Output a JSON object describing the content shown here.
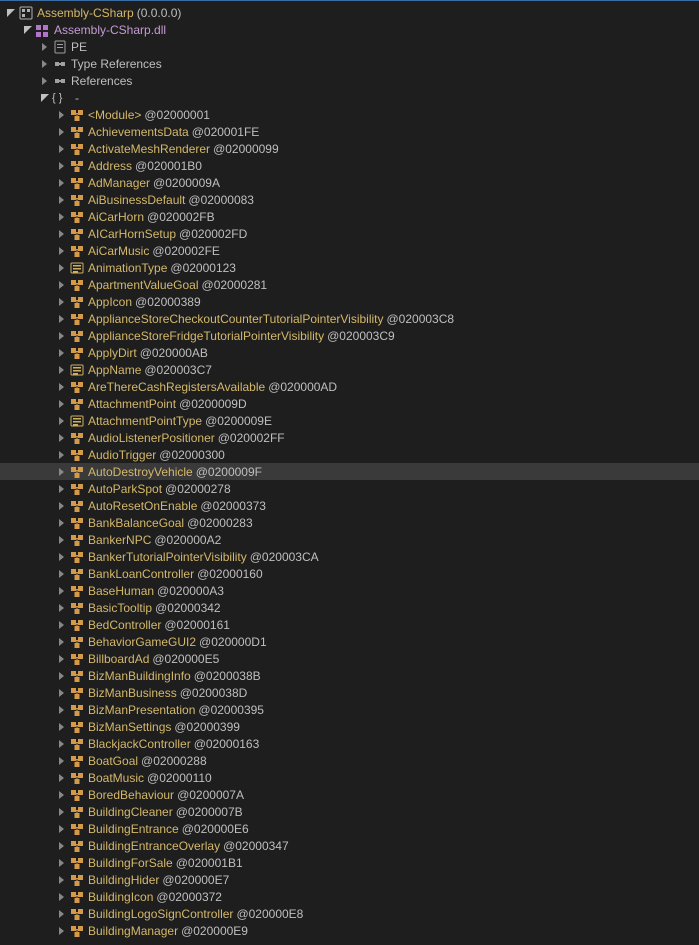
{
  "root": {
    "label": "Assembly-CSharp",
    "version": "(0.0.0.0)",
    "icon": "assembly"
  },
  "dll": {
    "label": "Assembly-CSharp.dll",
    "icon": "module"
  },
  "sections": {
    "pe": "PE",
    "typeRefs": "Type References",
    "refs": "References",
    "ns": "-"
  },
  "types": [
    {
      "name": "<Module>",
      "addr": "@02000001",
      "icon": "class"
    },
    {
      "name": "AchievementsData",
      "addr": "@020001FE",
      "icon": "class"
    },
    {
      "name": "ActivateMeshRenderer",
      "addr": "@02000099",
      "icon": "class"
    },
    {
      "name": "Address",
      "addr": "@020001B0",
      "icon": "class"
    },
    {
      "name": "AdManager",
      "addr": "@0200009A",
      "icon": "class"
    },
    {
      "name": "AiBusinessDefault",
      "addr": "@02000083",
      "icon": "class"
    },
    {
      "name": "AiCarHorn",
      "addr": "@020002FB",
      "icon": "class"
    },
    {
      "name": "AICarHornSetup",
      "addr": "@020002FD",
      "icon": "class"
    },
    {
      "name": "AiCarMusic",
      "addr": "@020002FE",
      "icon": "class"
    },
    {
      "name": "AnimationType",
      "addr": "@02000123",
      "icon": "enum"
    },
    {
      "name": "ApartmentValueGoal",
      "addr": "@02000281",
      "icon": "class"
    },
    {
      "name": "AppIcon",
      "addr": "@02000389",
      "icon": "class"
    },
    {
      "name": "ApplianceStoreCheckoutCounterTutorialPointerVisibility",
      "addr": "@020003C8",
      "icon": "class"
    },
    {
      "name": "ApplianceStoreFridgeTutorialPointerVisibility",
      "addr": "@020003C9",
      "icon": "class"
    },
    {
      "name": "ApplyDirt",
      "addr": "@020000AB",
      "icon": "class"
    },
    {
      "name": "AppName",
      "addr": "@020003C7",
      "icon": "enum"
    },
    {
      "name": "AreThereCashRegistersAvailable",
      "addr": "@020000AD",
      "icon": "class"
    },
    {
      "name": "AttachmentPoint",
      "addr": "@0200009D",
      "icon": "class"
    },
    {
      "name": "AttachmentPointType",
      "addr": "@0200009E",
      "icon": "enum"
    },
    {
      "name": "AudioListenerPositioner",
      "addr": "@020002FF",
      "icon": "class"
    },
    {
      "name": "AudioTrigger",
      "addr": "@02000300",
      "icon": "class"
    },
    {
      "name": "AutoDestroyVehicle",
      "addr": "@0200009F",
      "icon": "class",
      "selected": true
    },
    {
      "name": "AutoParkSpot",
      "addr": "@02000278",
      "icon": "class"
    },
    {
      "name": "AutoResetOnEnable",
      "addr": "@02000373",
      "icon": "class"
    },
    {
      "name": "BankBalanceGoal",
      "addr": "@02000283",
      "icon": "class"
    },
    {
      "name": "BankerNPC",
      "addr": "@020000A2",
      "icon": "class"
    },
    {
      "name": "BankerTutorialPointerVisibility",
      "addr": "@020003CA",
      "icon": "class"
    },
    {
      "name": "BankLoanController",
      "addr": "@02000160",
      "icon": "class"
    },
    {
      "name": "BaseHuman",
      "addr": "@020000A3",
      "icon": "class"
    },
    {
      "name": "BasicTooltip",
      "addr": "@02000342",
      "icon": "class"
    },
    {
      "name": "BedController",
      "addr": "@02000161",
      "icon": "class"
    },
    {
      "name": "BehaviorGameGUI2",
      "addr": "@020000D1",
      "icon": "class"
    },
    {
      "name": "BillboardAd",
      "addr": "@020000E5",
      "icon": "class"
    },
    {
      "name": "BizManBuildingInfo",
      "addr": "@0200038B",
      "icon": "class"
    },
    {
      "name": "BizManBusiness",
      "addr": "@0200038D",
      "icon": "class"
    },
    {
      "name": "BizManPresentation",
      "addr": "@02000395",
      "icon": "class"
    },
    {
      "name": "BizManSettings",
      "addr": "@02000399",
      "icon": "class"
    },
    {
      "name": "BlackjackController",
      "addr": "@02000163",
      "icon": "class"
    },
    {
      "name": "BoatGoal",
      "addr": "@02000288",
      "icon": "class"
    },
    {
      "name": "BoatMusic",
      "addr": "@02000110",
      "icon": "class"
    },
    {
      "name": "BoredBehaviour",
      "addr": "@0200007A",
      "icon": "class"
    },
    {
      "name": "BuildingCleaner",
      "addr": "@0200007B",
      "icon": "class"
    },
    {
      "name": "BuildingEntrance",
      "addr": "@020000E6",
      "icon": "class"
    },
    {
      "name": "BuildingEntranceOverlay",
      "addr": "@02000347",
      "icon": "class"
    },
    {
      "name": "BuildingForSale",
      "addr": "@020001B1",
      "icon": "class"
    },
    {
      "name": "BuildingHider",
      "addr": "@020000E7",
      "icon": "class"
    },
    {
      "name": "BuildingIcon",
      "addr": "@02000372",
      "icon": "class"
    },
    {
      "name": "BuildingLogoSignController",
      "addr": "@020000E8",
      "icon": "class"
    },
    {
      "name": "BuildingManager",
      "addr": "@020000E9",
      "icon": "class"
    }
  ]
}
